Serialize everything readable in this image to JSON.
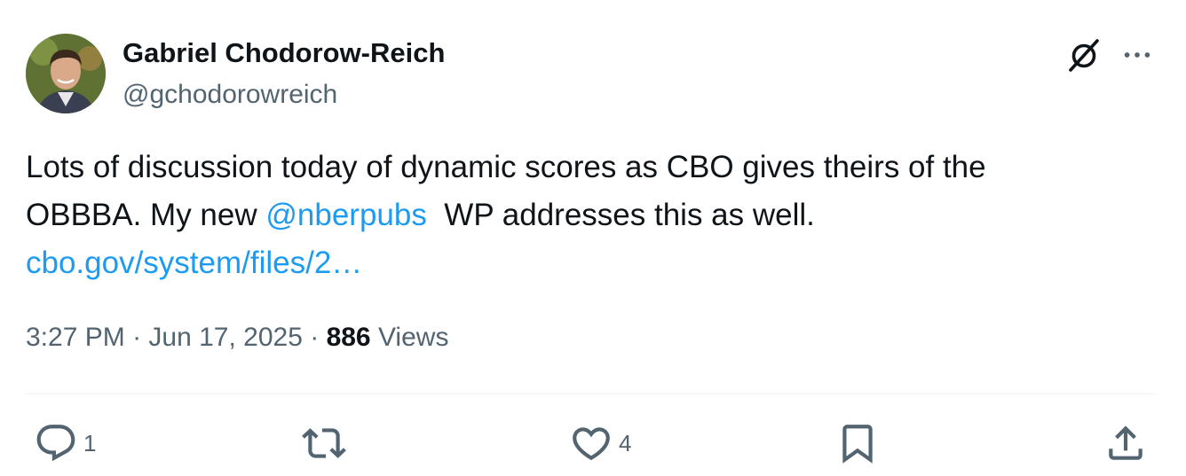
{
  "author": {
    "display_name": "Gabriel Chodorow-Reich",
    "handle": "@gchodorowreich"
  },
  "tweet": {
    "line1": "Lots of discussion today of dynamic scores as CBO gives theirs of the",
    "line2_prefix": "OBBBA. My new ",
    "mention": "@nberpubs",
    "line2_suffix": "  WP addresses this as well.",
    "link": "cbo.gov/system/files/2…"
  },
  "meta": {
    "time": "3:27 PM",
    "separator1": " · ",
    "date": "Jun 17, 2025",
    "separator2": " · ",
    "views_count": "886",
    "views_label": " Views"
  },
  "actions": {
    "reply_count": "1",
    "retweet_count": "",
    "like_count": "4"
  },
  "icons": {
    "grok": "grok-icon",
    "more": "more-icon",
    "reply": "reply-icon",
    "retweet": "retweet-icon",
    "like": "heart-icon",
    "bookmark": "bookmark-icon",
    "share": "share-icon"
  },
  "colors": {
    "text": "#0f1419",
    "secondary": "#536471",
    "link": "#1d9bf0",
    "divider": "#eff3f4"
  }
}
